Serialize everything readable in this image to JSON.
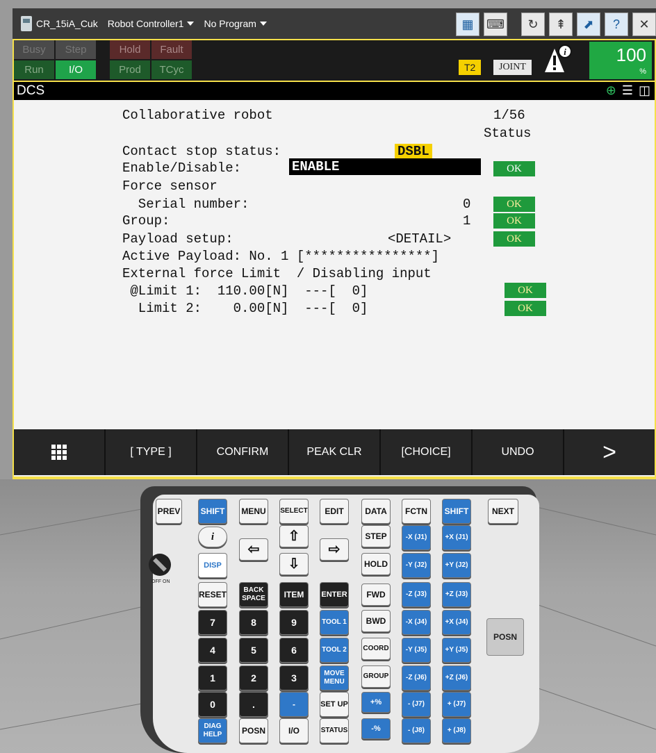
{
  "titlebar": {
    "robot_name": "CR_15iA_Cuk",
    "controller": "Robot Controller1",
    "program": "No Program"
  },
  "status": {
    "busy": "Busy",
    "step": "Step",
    "hold": "Hold",
    "fault": "Fault",
    "run": "Run",
    "io": "I/O",
    "prod": "Prod",
    "tcyc": "TCyc",
    "mode": "T2",
    "coord": "JOINT",
    "speed": "100",
    "speed_unit": "%"
  },
  "screen": {
    "title": "DCS",
    "header": "Collaborative robot",
    "page": "1/56",
    "col_status": "Status",
    "rows": {
      "contact_label": "Contact stop status:",
      "contact_value": "DSBL",
      "enable_label": "Enable/Disable:",
      "enable_value": "ENABLE",
      "enable_status": "OK",
      "force_label": "Force sensor",
      "serial_label": "  Serial number:",
      "serial_value": "0",
      "serial_status": "OK",
      "group_label": "Group:",
      "group_value": "1",
      "group_status": "OK",
      "payload_label": "Payload setup:",
      "payload_value": "<DETAIL>",
      "payload_status": "OK",
      "active_payload": "Active Payload: No. 1 [****************]",
      "ext_force": "External force Limit  / Disabling input",
      "limit1": " @Limit 1:  110.00[N]  ---[  0]",
      "limit1_status": "OK",
      "limit2": "  Limit 2:    0.00[N]  ---[  0]",
      "limit2_status": "OK"
    }
  },
  "fkeys": [
    "",
    "[ TYPE ]",
    "CONFIRM",
    "PEAK CLR",
    "[CHOICE]",
    "UNDO",
    ">"
  ],
  "keypad": {
    "prev": "PREV",
    "shift": "SHIFT",
    "menu": "MENU",
    "select": "SELECT",
    "edit": "EDIT",
    "data": "DATA",
    "fctn": "FCTN",
    "next": "NEXT",
    "info": "i",
    "step": "STEP",
    "disp": "DISP",
    "hold": "HOLD",
    "reset": "RESET",
    "backspace": "BACK SPACE",
    "item": "ITEM",
    "enter": "ENTER",
    "fwd": "FWD",
    "bwd": "BWD",
    "tool1": "TOOL 1",
    "tool2": "TOOL 2",
    "coord": "COORD",
    "move_menu": "MOVE MENU",
    "group": "GROUP",
    "setup": "SET UP",
    "status": "STATUS",
    "diag": "DIAG HELP",
    "posn": "POSN",
    "io": "I/O",
    "n7": "7",
    "n8": "8",
    "n9": "9",
    "n4": "4",
    "n5": "5",
    "n6": "6",
    "n1": "1",
    "n2": "2",
    "n3": "3",
    "n0": "0",
    "dot": ".",
    "minus": "-",
    "speed_up": "+%",
    "speed_down": "-%",
    "jog_xm": "-X (J1)",
    "jog_xp": "+X (J1)",
    "jog_ym": "-Y (J2)",
    "jog_yp": "+Y (J2)",
    "jog_zm": "-Z (J3)",
    "jog_zp": "+Z (J3)",
    "jog_rxm": "-X (J4)",
    "jog_rxp": "+X (J4)",
    "jog_rym": "-Y (J5)",
    "jog_ryp": "+Y (J5)",
    "jog_rzm": "-Z (J6)",
    "jog_rzp": "+Z (J6)",
    "j7m": "- (J7)",
    "j7p": "+ (J7)",
    "j8m": "- (J8)",
    "j8p": "+ (J8)",
    "side_posn": "POSN",
    "switch_off": "OFF",
    "switch_on": "ON"
  }
}
